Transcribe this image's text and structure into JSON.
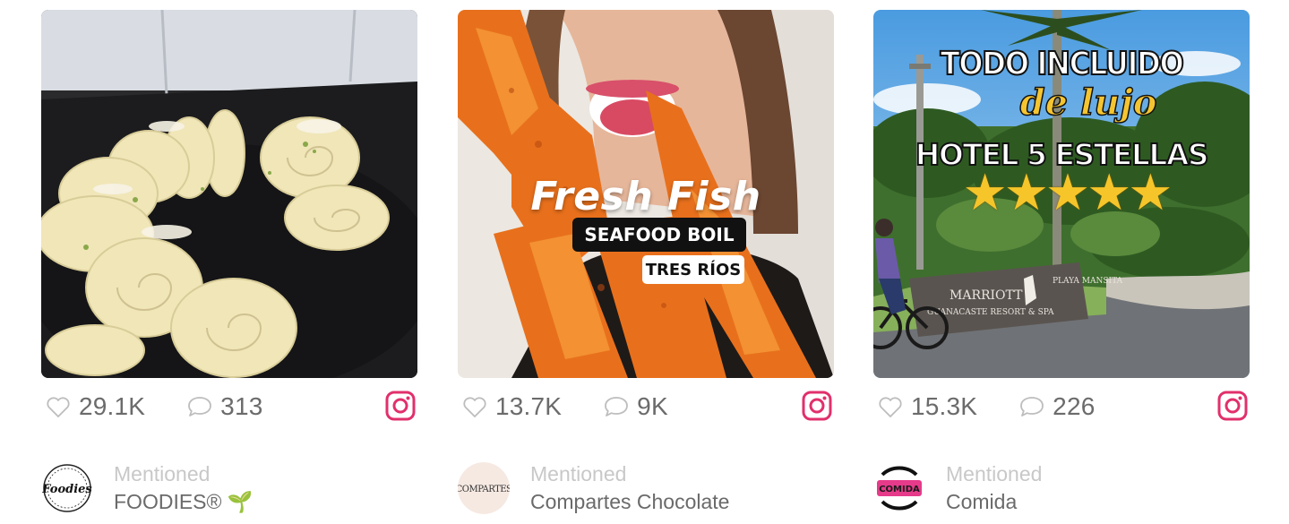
{
  "posts": [
    {
      "likes": "29.1K",
      "comments": "313",
      "mention_label": "Mentioned",
      "account_name": "FOODIES® 🌱",
      "avatar_text": "Foodies",
      "overlay": {}
    },
    {
      "likes": "13.7K",
      "comments": "9K",
      "mention_label": "Mentioned",
      "account_name": "Compartes Chocolate",
      "avatar_text": "COMPARTES",
      "overlay": {
        "headline": "Fresh Fish",
        "tag1": "SEAFOOD BOIL",
        "tag2": "TRES RÍOS"
      }
    },
    {
      "likes": "15.3K",
      "comments": "226",
      "mention_label": "Mentioned",
      "account_name": "Comida",
      "avatar_text": "COMIDA",
      "overlay": {
        "line1": "TODO INCLUIDO",
        "line2": "de lujo",
        "line3": "HOTEL 5 ESTELLAS",
        "stars": "★★★★★",
        "sign_text": "MARRIOTT",
        "sign_sub": "GUANACASTE RESORT & SPA",
        "sign_right": "PLAYA MANSITA"
      }
    }
  ],
  "colors": {
    "instagram": "#e1306c",
    "stat_text": "#6b6b6b",
    "mention_label": "#c8c8c8"
  },
  "icons": {
    "like": "heart-outline-icon",
    "comment": "speech-bubble-icon",
    "platform": "instagram-icon"
  }
}
